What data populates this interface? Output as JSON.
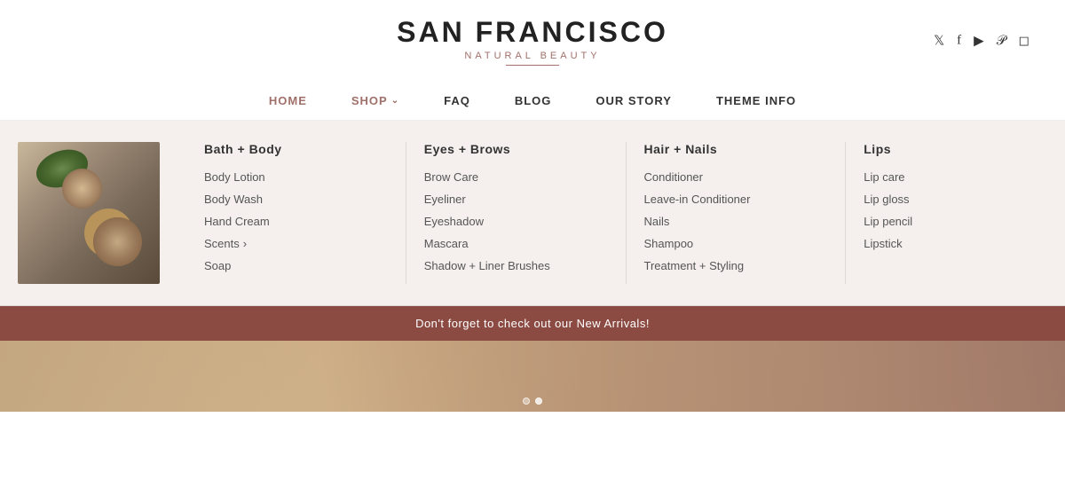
{
  "header": {
    "site_title": "SAN FRANCISCO",
    "site_subtitle": "NATURAL BEAUTY",
    "social_icons": [
      "twitter",
      "facebook",
      "youtube",
      "pinterest",
      "instagram"
    ]
  },
  "nav": {
    "items": [
      {
        "label": "HOME",
        "active": true,
        "id": "home"
      },
      {
        "label": "SHOP",
        "has_dropdown": true,
        "id": "shop"
      },
      {
        "label": "FAQ",
        "id": "faq"
      },
      {
        "label": "BLOG",
        "id": "blog"
      },
      {
        "label": "OUR STORY",
        "id": "our-story"
      },
      {
        "label": "THEME INFO",
        "id": "theme-info"
      }
    ]
  },
  "dropdown": {
    "columns": [
      {
        "title": "Bath + Body",
        "items": [
          {
            "label": "Body Lotion"
          },
          {
            "label": "Body Wash"
          },
          {
            "label": "Hand Cream"
          },
          {
            "label": "Scents",
            "has_arrow": true
          },
          {
            "label": "Soap"
          }
        ]
      },
      {
        "title": "Eyes + Brows",
        "items": [
          {
            "label": "Brow Care"
          },
          {
            "label": "Eyeliner"
          },
          {
            "label": "Eyeshadow"
          },
          {
            "label": "Mascara"
          },
          {
            "label": "Shadow + Liner Brushes"
          }
        ]
      },
      {
        "title": "Hair + Nails",
        "items": [
          {
            "label": "Conditioner"
          },
          {
            "label": "Leave-in Conditioner"
          },
          {
            "label": "Nails"
          },
          {
            "label": "Shampoo"
          },
          {
            "label": "Treatment + Styling"
          }
        ]
      },
      {
        "title": "Lips",
        "items": [
          {
            "label": "Lip care"
          },
          {
            "label": "Lip gloss"
          },
          {
            "label": "Lip pencil"
          },
          {
            "label": "Lipstick"
          }
        ]
      }
    ]
  },
  "promo_banner": {
    "text": "Don't forget to check out our New Arrivals!"
  },
  "hero_dots": [
    {
      "active": false
    },
    {
      "active": true
    }
  ]
}
